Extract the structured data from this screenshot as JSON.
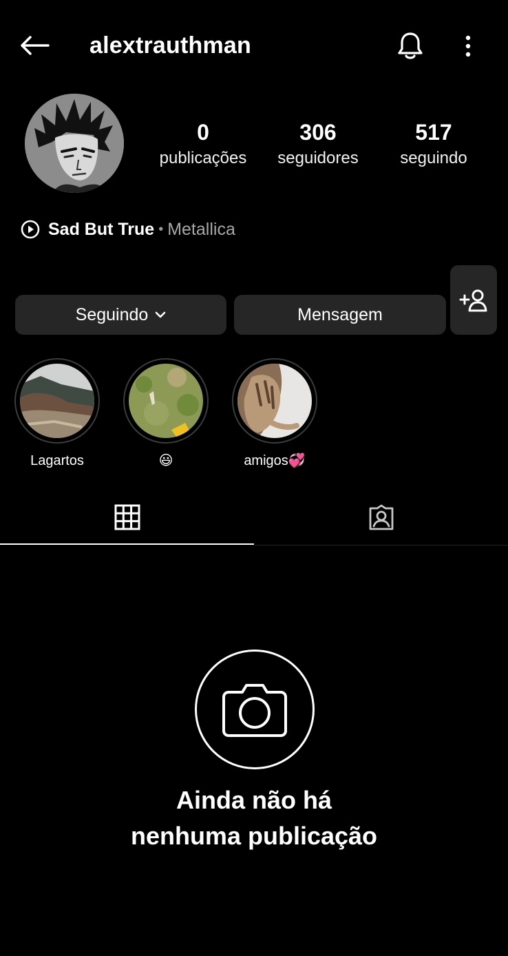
{
  "header": {
    "username": "alextrauthman",
    "back_icon": "arrow-left-icon",
    "bell_icon": "bell-icon",
    "more_icon": "more-vertical-icon"
  },
  "profile": {
    "avatar_alt": "avatar",
    "stats": [
      {
        "value": "0",
        "label": "publicações"
      },
      {
        "value": "306",
        "label": "seguidores"
      },
      {
        "value": "517",
        "label": "seguindo"
      }
    ],
    "music": {
      "song": "Sad But True",
      "separator": "•",
      "artist": "Metallica"
    }
  },
  "actions": {
    "following_label": "Seguindo",
    "message_label": "Mensagem",
    "add_user_icon": "add-user-icon"
  },
  "highlights": [
    {
      "label": "Lagartos"
    },
    {
      "label": "😃"
    },
    {
      "label": "amigos💞"
    }
  ],
  "tabs": {
    "grid_icon": "grid-icon",
    "tagged_icon": "tagged-icon",
    "active": "grid"
  },
  "empty_state": {
    "line1": "Ainda não há",
    "line2": "nenhuma publicação"
  },
  "colors": {
    "background": "#000000",
    "button": "#262626",
    "muted_text": "#a8a8a8"
  }
}
